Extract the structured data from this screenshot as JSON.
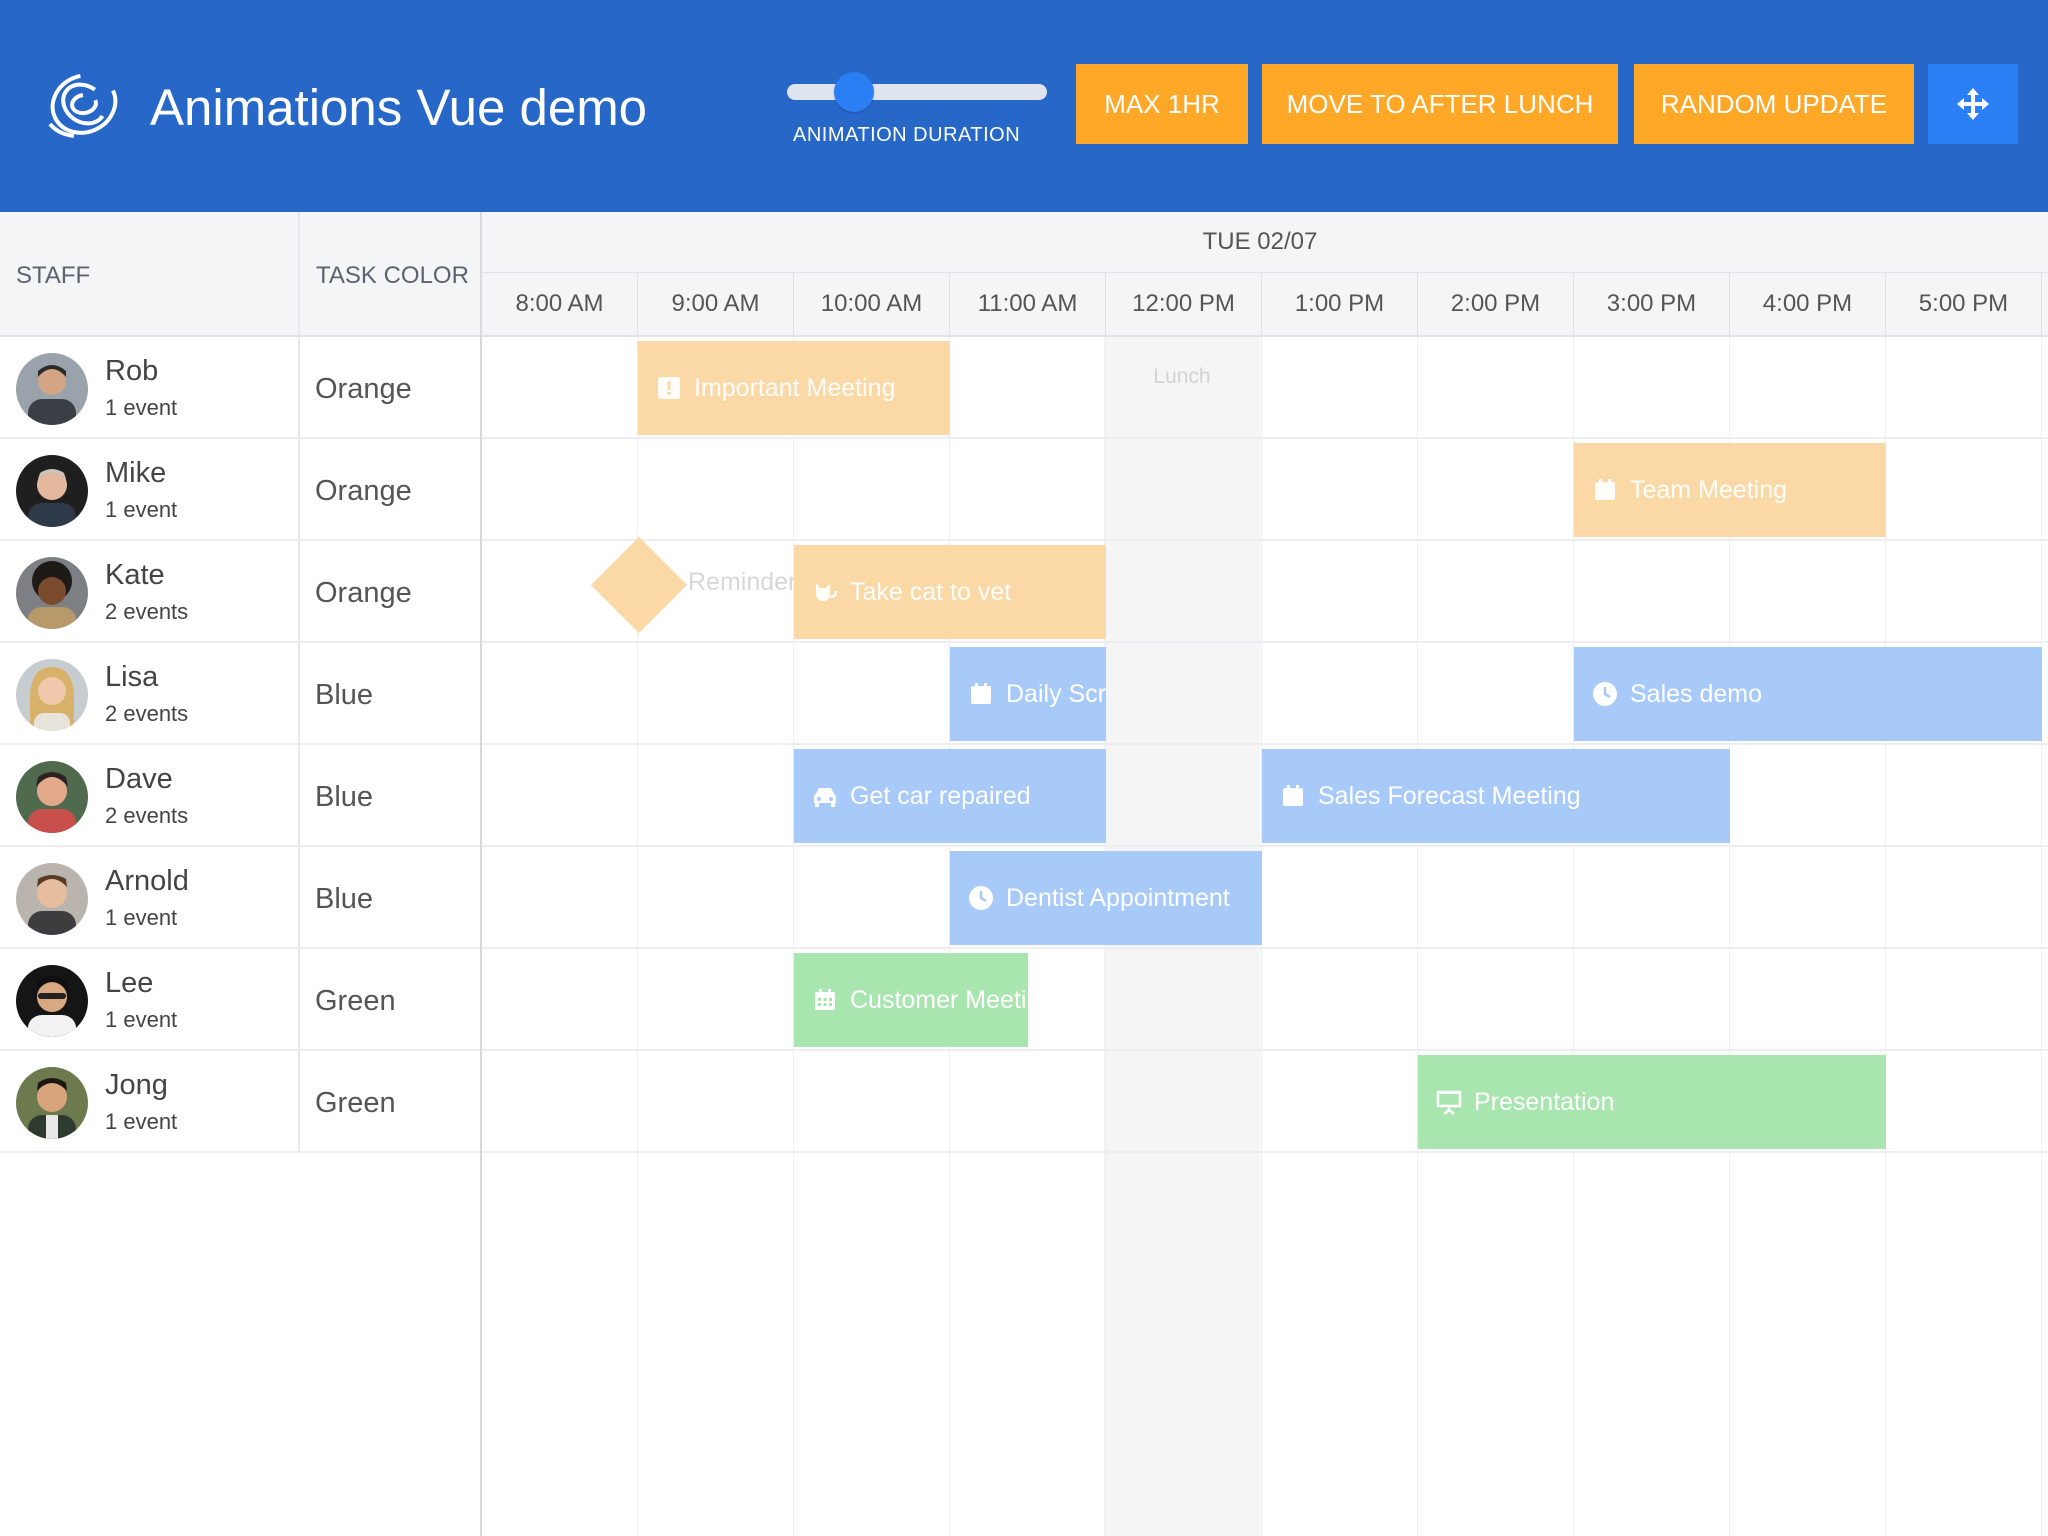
{
  "app": {
    "title": "Animations Vue demo"
  },
  "controls": {
    "slider_label": "ANIMATION DURATION",
    "slider_value_fraction": 0.2,
    "buttons": {
      "max": "MAX 1HR",
      "lunch": "MOVE TO AFTER LUNCH",
      "random": "RANDOM UPDATE"
    },
    "move_icon": "move-arrows-icon"
  },
  "grid": {
    "headers": {
      "staff": "STAFF",
      "task_color": "TASK COLOR"
    },
    "date": "TUE 02/07",
    "times": [
      "8:00 AM",
      "9:00 AM",
      "10:00 AM",
      "11:00 AM",
      "12:00 PM",
      "1:00 PM",
      "2:00 PM",
      "3:00 PM",
      "4:00 PM",
      "5:00 PM"
    ],
    "lunch_label": "Lunch",
    "staff": [
      {
        "name": "Rob",
        "events": "1 event",
        "color": "Orange"
      },
      {
        "name": "Mike",
        "events": "1 event",
        "color": "Orange"
      },
      {
        "name": "Kate",
        "events": "2 events",
        "color": "Orange"
      },
      {
        "name": "Lisa",
        "events": "2 events",
        "color": "Blue"
      },
      {
        "name": "Dave",
        "events": "2 events",
        "color": "Blue"
      },
      {
        "name": "Arnold",
        "events": "1 event",
        "color": "Blue"
      },
      {
        "name": "Lee",
        "events": "1 event",
        "color": "Green"
      },
      {
        "name": "Jong",
        "events": "1 event",
        "color": "Green"
      }
    ],
    "events": {
      "important_meeting": "Important Meeting",
      "team_meeting": "Team Meeting",
      "reminder": "Reminder!",
      "take_cat": "Take cat to vet",
      "daily_scrum": "Daily Scru",
      "sales_demo": "Sales demo",
      "get_car": "Get car repaired",
      "sales_forecast": "Sales Forecast Meeting",
      "dentist": "Dentist Appointment",
      "customer_meeting": "Customer Meetin",
      "presentation": "Presentation"
    }
  },
  "colors": {
    "header_bg": "#2667c8",
    "accent_orange": "#ffa726",
    "accent_blue": "#2b7ff5",
    "event_orange": "#fbd9a6",
    "event_blue": "#a8caf9",
    "event_green": "#a9e6af"
  }
}
